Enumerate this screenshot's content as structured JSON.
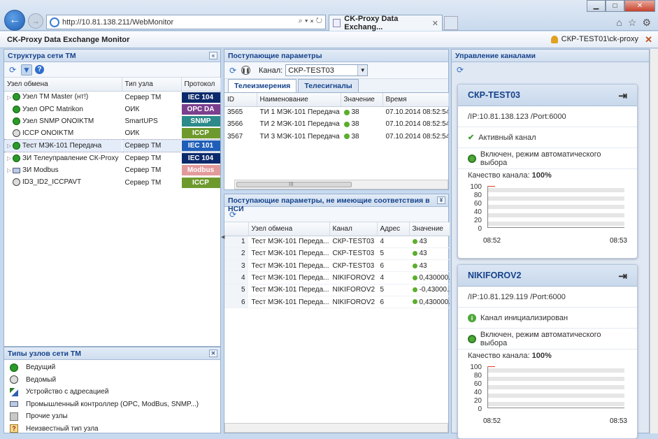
{
  "browser": {
    "url": "http://10.81.138.211/WebMonitor",
    "tab_title": "CK-Proxy Data Exchang...",
    "win_min": "▁",
    "win_max": "□",
    "win_close": "✕"
  },
  "app": {
    "title": "CK-Proxy Data Exchange Monitor",
    "user": "СКР-TEST01\\ck-proxy"
  },
  "tree_panel": {
    "title": "Структура сети ТМ",
    "columns": [
      "Узел обмена",
      "Тип узла",
      "Протокол"
    ],
    "rows": [
      {
        "name": "Узел TM Master (нт!)",
        "type": "Сервер ТМ",
        "protocol": "IEC 104",
        "pcolor": "#0c2a6b",
        "icon": "green",
        "expand": "▷"
      },
      {
        "name": "Узел OPC Matrikon",
        "type": "ОИК",
        "protocol": "OPC DA",
        "pcolor": "#7b3f8e",
        "icon": "green",
        "expand": ""
      },
      {
        "name": "Узел SNMP ONOIKTM",
        "type": "SmartUPS",
        "protocol": "SNMP",
        "pcolor": "#2d8a8a",
        "icon": "green",
        "expand": ""
      },
      {
        "name": "ICCP ONOIKTM",
        "type": "ОИК",
        "protocol": "ICCP",
        "pcolor": "#6e9a2d",
        "icon": "grey",
        "expand": ""
      },
      {
        "name": "Тест МЭК-101 Передача",
        "type": "Сервер ТМ",
        "protocol": "IEC 101",
        "pcolor": "#1f5fb8",
        "icon": "green",
        "expand": "▷"
      },
      {
        "name": "ЗИ Телеуправление СК-Proxy",
        "type": "Сервер ТМ",
        "protocol": "IEC 104",
        "pcolor": "#0c2a6b",
        "icon": "green",
        "expand": "▷"
      },
      {
        "name": "ЗИ Modbus",
        "type": "Сервер ТМ",
        "protocol": "Modbus",
        "pcolor": "#e29a9a",
        "icon": "pc",
        "expand": "▷"
      },
      {
        "name": "ID3_ID2_ICCPAVT",
        "type": "Сервер ТМ",
        "protocol": "ICCP",
        "pcolor": "#6e9a2d",
        "icon": "grey",
        "expand": ""
      }
    ]
  },
  "legend_panel": {
    "title": "Типы узлов сети ТМ",
    "items": [
      {
        "label": "Ведущий",
        "icon": "leader-icon"
      },
      {
        "label": "Ведомый",
        "icon": "follower-icon"
      },
      {
        "label": "Устройство с адресацией",
        "icon": "addressed-device-icon"
      },
      {
        "label": "Промышленный контроллер (OPC, ModBus, SNMP...)",
        "icon": "controller-icon"
      },
      {
        "label": "Прочие узлы",
        "icon": "other-node-icon"
      },
      {
        "label": "Неизвестный тип узла",
        "icon": "unknown-node-icon"
      }
    ]
  },
  "params_panel": {
    "title": "Поступающие параметры",
    "channel_label": "Канал:",
    "channel_value": "СКР-TEST03",
    "tabs": [
      "Телеизмерения",
      "Телесигналы"
    ],
    "columns": [
      "ID",
      "Наименование",
      "Значение",
      "Время"
    ],
    "rows": [
      {
        "id": "3565",
        "name": "ТИ 1 МЭК-101 Передача",
        "value": "38",
        "time": "07.10.2014 08:52:54."
      },
      {
        "id": "3566",
        "name": "ТИ 2 МЭК-101 Передача",
        "value": "38",
        "time": "07.10.2014 08:52:54."
      },
      {
        "id": "3567",
        "name": "ТИ 3 МЭК-101 Передача",
        "value": "38",
        "time": "07.10.2014 08:52:54."
      }
    ],
    "scroll_grip": "III"
  },
  "unmatched_panel": {
    "title": "Поступающие параметры, не имеющие соответствия в НСИ",
    "columns": [
      "",
      "Узел обмена",
      "Канал",
      "Адрес",
      "Значение"
    ],
    "rows": [
      {
        "n": "1",
        "node": "Тест МЭК-101 Переда...",
        "channel": "СКР-TEST03",
        "addr": "4",
        "value": "43"
      },
      {
        "n": "2",
        "node": "Тест МЭК-101 Переда...",
        "channel": "СКР-TEST03",
        "addr": "5",
        "value": "43"
      },
      {
        "n": "3",
        "node": "Тест МЭК-101 Переда...",
        "channel": "СКР-TEST03",
        "addr": "6",
        "value": "43"
      },
      {
        "n": "4",
        "node": "Тест МЭК-101 Переда...",
        "channel": "NIKIFOROV2",
        "addr": "4",
        "value": "0,430000..."
      },
      {
        "n": "5",
        "node": "Тест МЭК-101 Переда...",
        "channel": "NIKIFOROV2",
        "addr": "5",
        "value": "-0,43000..."
      },
      {
        "n": "6",
        "node": "Тест МЭК-101 Переда...",
        "channel": "NIKIFOROV2",
        "addr": "6",
        "value": "0,430000..."
      }
    ]
  },
  "channels_panel": {
    "title": "Управление каналами",
    "cards": [
      {
        "name": "СКР-TEST03",
        "address": "/IP:10.81.138.123  /Port:6000",
        "status": "Активный канал",
        "mode": "Включен, режим автоматического выбора",
        "quality_label": "Качество канала:",
        "quality_value": "100%",
        "y_ticks": [
          "100",
          "80",
          "60",
          "40",
          "20",
          "0"
        ],
        "x_ticks": [
          "08:52",
          "08:53"
        ],
        "quality_level": 100
      },
      {
        "name": "NIKIFOROV2",
        "address": "/IP:10.81.129.119  /Port:6000",
        "status": "Канал инициализирован",
        "mode": "Включен, режим автоматического выбора",
        "quality_label": "Качество канала:",
        "quality_value": "100%",
        "y_ticks": [
          "100",
          "80",
          "60",
          "40",
          "20",
          "0"
        ],
        "x_ticks": [
          "08:52",
          "08:53"
        ],
        "quality_level": 100
      }
    ]
  }
}
